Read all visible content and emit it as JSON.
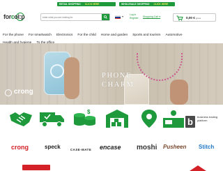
{
  "topbar": {
    "retail_label": "RETAIL SHOPPING",
    "retail_link": "CLICK HERE",
    "wholesale_label": "WHOLESALE SHOPPING",
    "wholesale_link": "CLICK HERE",
    "accent": "#1e9a3c"
  },
  "header": {
    "logo_left": "for",
    "logo_right": "ol:p",
    "search_placeholder": "enter what you are looking for",
    "language": "cz",
    "login_line1": "Log in",
    "login_line2": "Register",
    "shopping_cart_label": "Shopping Cart",
    "cart_amount": "0,00 €",
    "cart_suffix": "gross"
  },
  "nav": {
    "row1": [
      "For the phone",
      "For smartwatch",
      "Electronics",
      "For the child",
      "Home and garden",
      "Sports and tourism",
      "Automotive"
    ],
    "row2": [
      "Health and hygiene",
      "To the office"
    ]
  },
  "banner": {
    "headline_line1": "PHONE",
    "headline_line2": "CHARM",
    "brand": "crong"
  },
  "icons": {
    "items": [
      "handshake-icon",
      "delivery-truck-icon",
      "coins-icon",
      "warehouse-icon",
      "location-pin-icon",
      "registration-desk-icon"
    ],
    "business_label": "business trading platform",
    "business_letter": "b"
  },
  "brands": [
    "crong",
    "speck",
    "CASE-MATE",
    "encase",
    "moshi",
    "Pusheen",
    "Stitch"
  ]
}
